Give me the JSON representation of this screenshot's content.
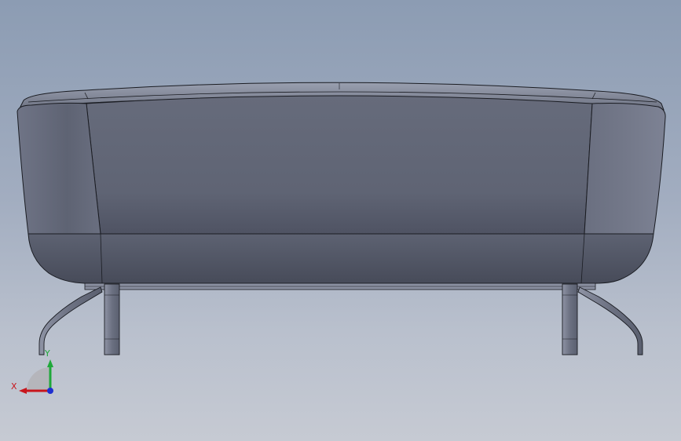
{
  "viewport": {
    "model_view": "sofa-back-view"
  },
  "triad": {
    "x_label": "X",
    "y_label": "Y",
    "x_color": "#c8161d",
    "y_color": "#1fa83a",
    "z_color": "#1f2fd0"
  },
  "colors": {
    "background_top": "#8c9cb3",
    "background_bottom": "#c6cad3",
    "body": "#636979",
    "edge": "#1a1c22"
  }
}
